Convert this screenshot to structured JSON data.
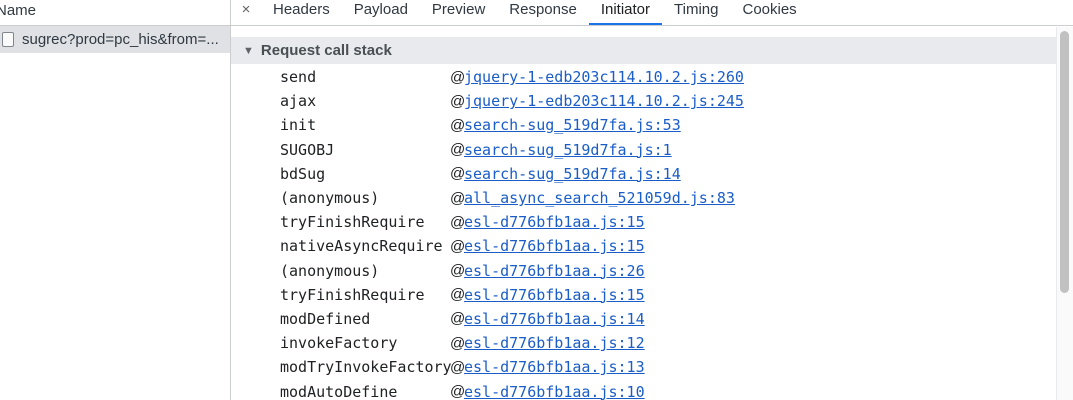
{
  "request_list": {
    "header": "Name",
    "selected_request": "sugrec?prod=pc_his&from=..."
  },
  "details": {
    "close_glyph": "×",
    "tabs": [
      {
        "label": "Headers"
      },
      {
        "label": "Payload"
      },
      {
        "label": "Preview"
      },
      {
        "label": "Response"
      },
      {
        "label": "Initiator"
      },
      {
        "label": "Timing"
      },
      {
        "label": "Cookies"
      }
    ],
    "active_tab": "Initiator",
    "section_title": "Request call stack",
    "caret_glyph": "▼",
    "at_glyph": "@",
    "call_stack": [
      {
        "fn": "send",
        "loc": "jquery-1-edb203c114.10.2.js:260"
      },
      {
        "fn": "ajax",
        "loc": "jquery-1-edb203c114.10.2.js:245"
      },
      {
        "fn": "init",
        "loc": "search-sug_519d7fa.js:53"
      },
      {
        "fn": "SUGOBJ",
        "loc": "search-sug_519d7fa.js:1"
      },
      {
        "fn": "bdSug",
        "loc": "search-sug_519d7fa.js:14"
      },
      {
        "fn": "(anonymous)",
        "loc": "all_async_search_521059d.js:83"
      },
      {
        "fn": "tryFinishRequire",
        "loc": "esl-d776bfb1aa.js:15"
      },
      {
        "fn": "nativeAsyncRequire",
        "loc": "esl-d776bfb1aa.js:15"
      },
      {
        "fn": "(anonymous)",
        "loc": "esl-d776bfb1aa.js:26"
      },
      {
        "fn": "tryFinishRequire",
        "loc": "esl-d776bfb1aa.js:15"
      },
      {
        "fn": "modDefined",
        "loc": "esl-d776bfb1aa.js:14"
      },
      {
        "fn": "invokeFactory",
        "loc": "esl-d776bfb1aa.js:12"
      },
      {
        "fn": "modTryInvokeFactory",
        "loc": "esl-d776bfb1aa.js:13"
      },
      {
        "fn": "modAutoDefine",
        "loc": "esl-d776bfb1aa.js:10"
      }
    ]
  },
  "colors": {
    "link": "#1a5dc8",
    "active_tab_underline": "#1a73e8",
    "section_header_bg": "#e8eaed",
    "selected_row_bg": "#dfe1e5"
  }
}
